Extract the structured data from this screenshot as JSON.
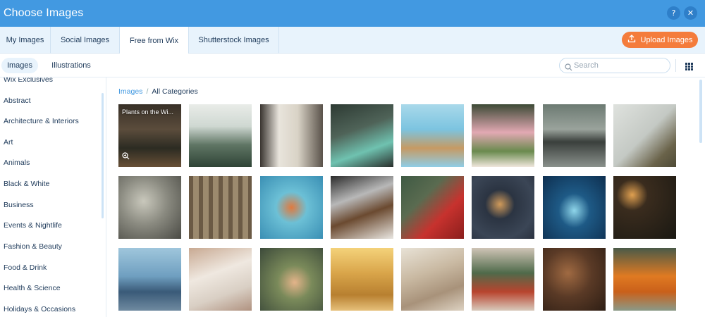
{
  "dialog": {
    "title": "Choose Images",
    "help_glyph": "?",
    "close_glyph": "✕"
  },
  "tabs": [
    {
      "label": "My Images"
    },
    {
      "label": "Social Images"
    },
    {
      "label": "Free from Wix"
    },
    {
      "label": "Shutterstock Images"
    }
  ],
  "upload": {
    "label": "Upload Images",
    "icon": "upload-icon",
    "color": "#f47c3c"
  },
  "subtabs": [
    {
      "label": "Images"
    },
    {
      "label": "Illustrations"
    }
  ],
  "search": {
    "placeholder": "Search",
    "value": ""
  },
  "categories": [
    "Wix Exclusives",
    "Abstract",
    "Architecture & Interiors",
    "Art",
    "Animals",
    "Black & White",
    "Business",
    "Events & Nightlife",
    "Fashion & Beauty",
    "Food & Drink",
    "Health & Science",
    "Holidays & Occasions"
  ],
  "breadcrumb": {
    "root": "Images",
    "separator": "/",
    "current": "All Categories"
  },
  "hover_label": "Plants on the Wi...",
  "colors": {
    "accent": "#4299e1",
    "header_bg": "#4299e1",
    "tab_bg": "#e8f3fc"
  }
}
